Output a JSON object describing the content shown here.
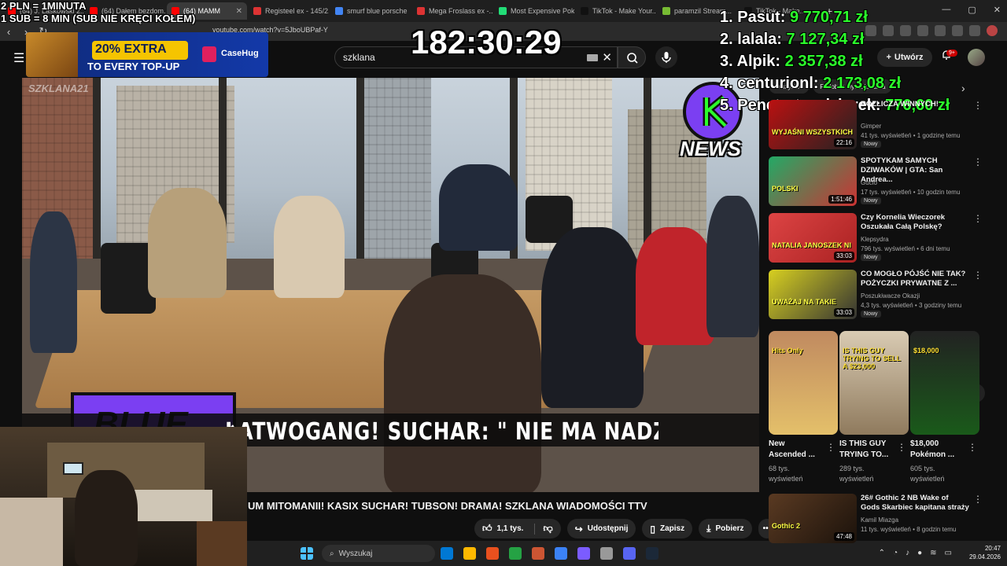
{
  "browser": {
    "tabs": [
      {
        "label": "(64) J. Laskowski 2...",
        "favicon_color": "#ff0000",
        "active": false
      },
      {
        "label": "(64) Dałem bezdom...",
        "favicon_color": "#ff0000",
        "active": false
      },
      {
        "label": "(64) MAMM",
        "favicon_color": "#ff0000",
        "active": true
      },
      {
        "label": "Registeel ex - 145/2...",
        "favicon_color": "#d33",
        "active": false
      },
      {
        "label": "smurf blue porsche",
        "favicon_color": "#4285f4",
        "active": false
      },
      {
        "label": "Mega Froslass ex -...",
        "favicon_color": "#d33",
        "active": false
      },
      {
        "label": "Most Expensive Pok...",
        "favicon_color": "#2d7",
        "active": false
      },
      {
        "label": "TikTok - Make Your...",
        "favicon_color": "#111",
        "active": false
      },
      {
        "label": "paramzil Stream...",
        "favicon_color": "#7b3",
        "active": false
      },
      {
        "label": "TikTok - Make...",
        "favicon_color": "#111",
        "active": false
      }
    ],
    "url": "youtube.com/watch?v=5JboUBPaf-Y",
    "new_tab": "+"
  },
  "youtube": {
    "search_value": "szklana",
    "create_label": "Utwórz",
    "notif_badge": "9+",
    "video_title": "UM MITOMANII! KASIX SUCHAR! TUBSON! DRAMA! SZKLANA WIADOMOŚCI TTV",
    "actions": {
      "likes": "1,1 tys.",
      "share": "Udostępnij",
      "save": "Zapisz",
      "download": "Pobierz"
    },
    "video_overlay": {
      "watermark": "SZKLANA21",
      "knews": "NEWS",
      "ticker": "ŁATWOGANG! SUCHAR: \" NIE MA NADZIEI DLA TE",
      "purple_text": "BLUE"
    },
    "chips": [
      "Wszystko",
      "Podobne wyszukiwania"
    ],
    "recommendations": [
      {
        "title": "ROZLICZA WINNYCH!",
        "channel": "Gimper",
        "meta": "41 tys. wyświetleń • 1 godzinę temu",
        "badge": "Nowy",
        "duration": "22:16",
        "thumb_text": "WYJAŚNI WSZYSTKICH"
      },
      {
        "title": "SPOTYKAM SAMYCH DZIWAKÓW | GTA: San Andrea...",
        "channel": "Gucio",
        "meta": "17 tys. wyświetleń • 10 godzin temu",
        "badge": "Nowy",
        "duration": "1:51:46",
        "thumb_text": "POLSKI"
      },
      {
        "title": "Czy Kornelia Wieczorek Oszukała Całą Polskę?",
        "channel": "Klepsydra",
        "meta": "796 tys. wyświetleń • 6 dni temu",
        "badge": "Nowy",
        "duration": "33:03",
        "thumb_text": "NATALIA JANOSZEK NI"
      },
      {
        "title": "CO MOGŁO PÓJŚĆ NIE TAK? POŻYCZKI PRYWATNE Z ...",
        "channel": "Poszukiwacze Okazji",
        "meta": "4,3 tys. wyświetleń • 3 godziny temu",
        "badge": "Nowy",
        "duration": "33:03",
        "thumb_text": "UWAŻAJ NA TAKIE"
      },
      {
        "title": "26# Gothic 2 NB Wake of Gods Skarbiec kapitana straży",
        "channel": "Kamil Miazga",
        "meta": "11 tys. wyświetleń • 8 godzin temu",
        "badge": "",
        "duration": "47:48",
        "thumb_text": "Gothic 2"
      }
    ],
    "shorts": [
      {
        "title": "New Ascended ...",
        "views": "68 tys. wyświetleń",
        "thumb_text": "Hits Only"
      },
      {
        "title": "IS THIS GUY TRYING TO...",
        "views": "289 tys. wyświetleń",
        "thumb_text": "IS THIS GUY TRYING TO SELL A $23,000"
      },
      {
        "title": "$18,000 Pokémon ...",
        "views": "605 tys. wyświetleń",
        "thumb_text": "$18,000"
      }
    ]
  },
  "stream_overlay": {
    "rules": [
      "2 PLN = 1MINUTA",
      "1 SUB = 8 MIN (SUB NIE KRĘCI KOŁEM)"
    ],
    "timer": "182:30:29",
    "leaderboard": [
      {
        "rank": "1.",
        "name": "Pasut:",
        "amount": "9 770,71 zł"
      },
      {
        "rank": "2.",
        "name": "lalala:",
        "amount": "7 127,34 zł"
      },
      {
        "rank": "3.",
        "name": "Alpik:",
        "amount": "2 357,38 zł"
      },
      {
        "rank": "4.",
        "name": "centurionl:",
        "amount": "2 173,08 zł"
      },
      {
        "rank": "5.",
        "name": "Penetrator dziurek:",
        "amount": "776,60 zł"
      }
    ],
    "promo": {
      "big": "20% EXTRA",
      "sub": "TO EVERY TOP-UP",
      "brand": "CaseHug"
    }
  },
  "taskbar": {
    "search_placeholder": "Wyszukaj",
    "time": "20:47",
    "date": "29.04.2026",
    "icon_colors": [
      "#0078d4",
      "#ffb900",
      "#e8501e",
      "#25a244",
      "#c53",
      "#3b82f6",
      "#7b5cff",
      "#999",
      "#5865f2",
      "#1b2838"
    ]
  },
  "colors": {
    "accent_green": "#2bff2b",
    "yt_red": "#ff0000",
    "purple": "#7b3ff2"
  }
}
